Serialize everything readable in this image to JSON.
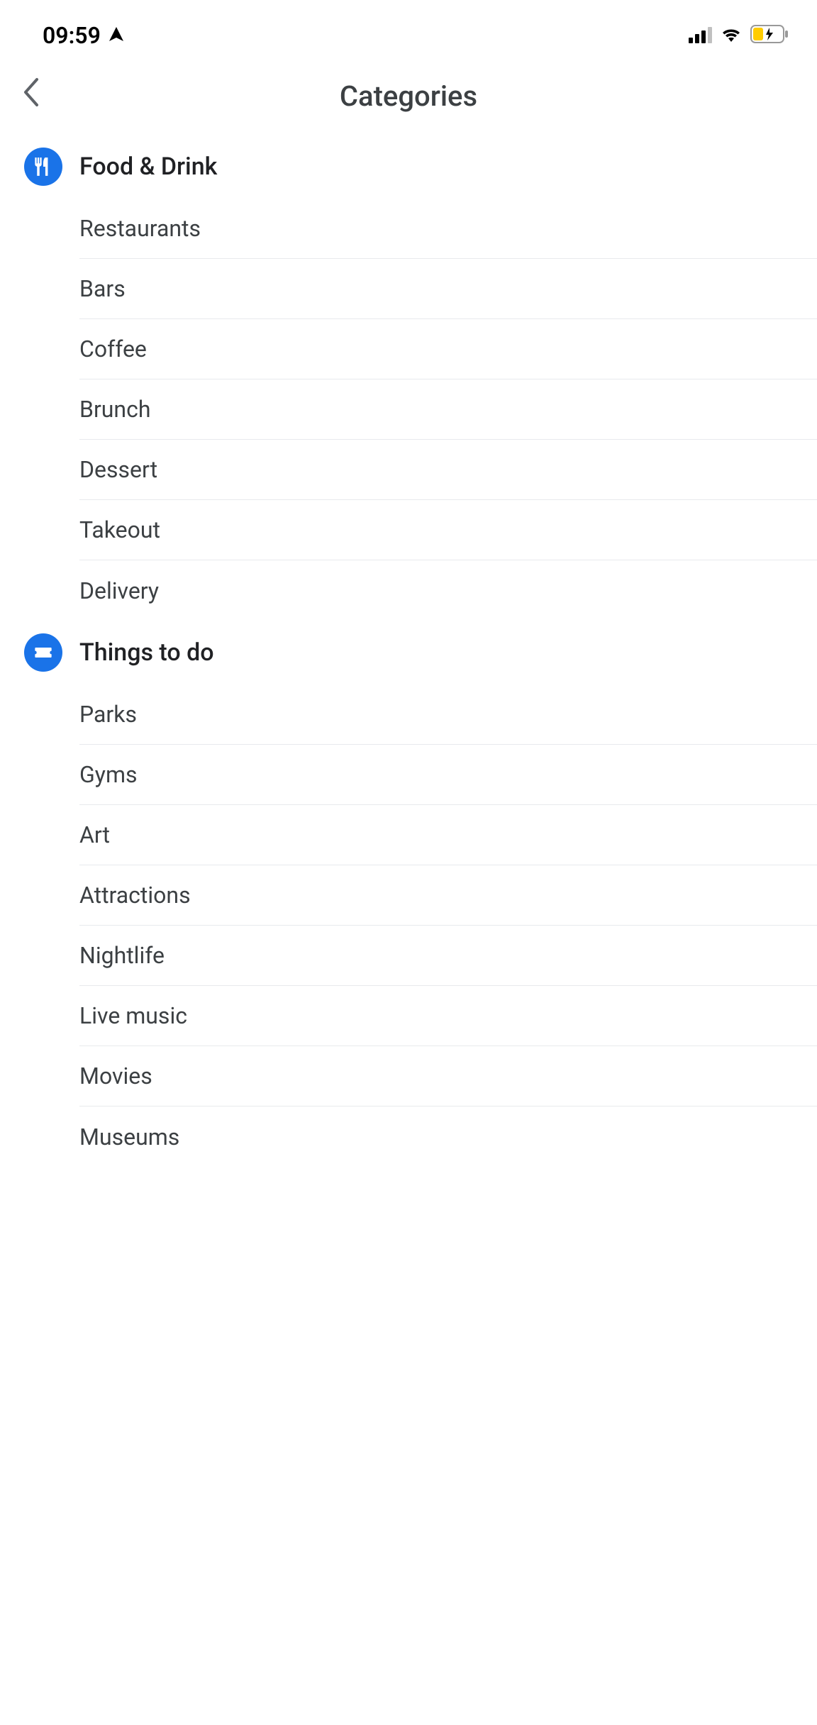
{
  "statusBar": {
    "time": "09:59"
  },
  "header": {
    "title": "Categories"
  },
  "sections": [
    {
      "icon": "utensils",
      "title": "Food & Drink",
      "items": [
        "Restaurants",
        "Bars",
        "Coffee",
        "Brunch",
        "Dessert",
        "Takeout",
        "Delivery"
      ]
    },
    {
      "icon": "ticket",
      "title": "Things to do",
      "items": [
        "Parks",
        "Gyms",
        "Art",
        "Attractions",
        "Nightlife",
        "Live music",
        "Movies",
        "Museums"
      ]
    }
  ]
}
